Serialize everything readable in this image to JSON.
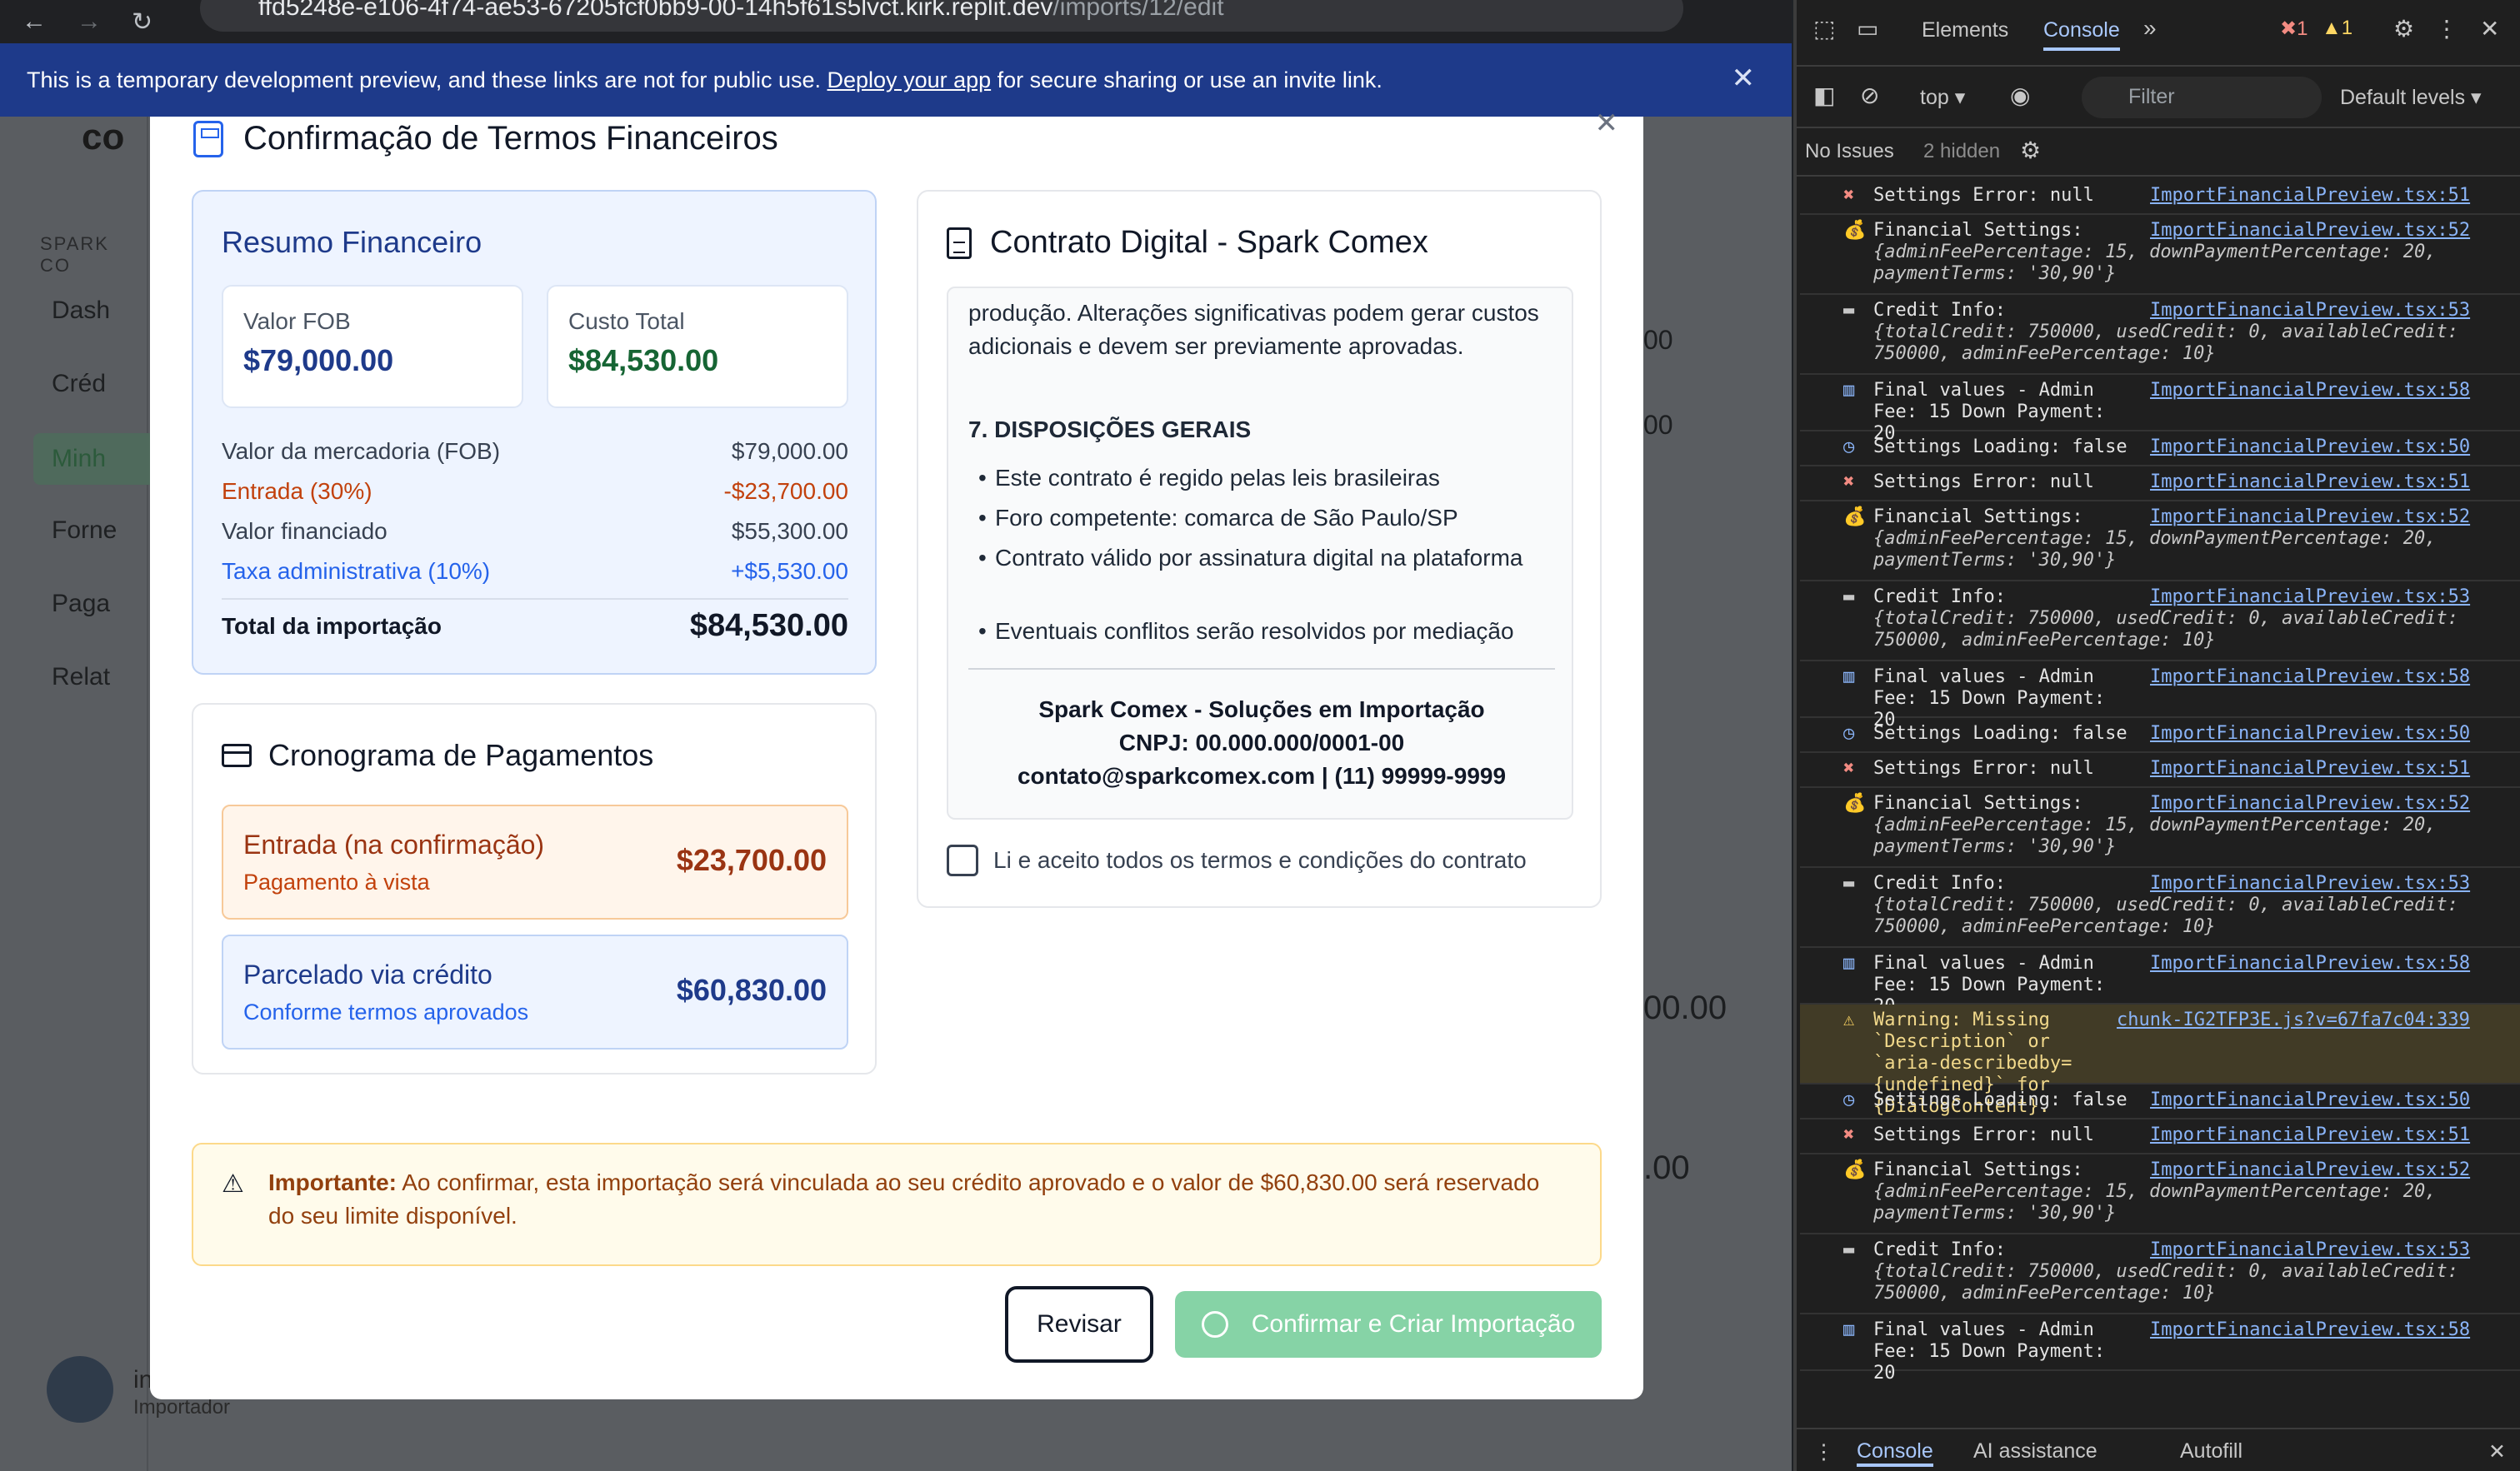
{
  "browser": {
    "url_main": "ffd5248e-e106-4f74-ae53-67205fcf0bb9-00-14h5f61s5lvct.kirk.replit.dev",
    "url_path": "/imports/12/edit"
  },
  "banner": {
    "text_before": "This is a temporary development preview, and these links are not for public use.",
    "link": "Deploy your app",
    "text_after": "for secure sharing or use an invite link."
  },
  "background": {
    "brand": "co",
    "section": "SPARK CO",
    "items": [
      "Dash",
      "Créd",
      "Minh",
      "Forne",
      "Paga",
      "Relat"
    ],
    "numbers": [
      "00",
      "00",
      "00.00",
      ".00"
    ],
    "user_name": "in",
    "user_role": "Importador"
  },
  "modal": {
    "title": "Confirmação de Termos Financeiros",
    "summary": {
      "title": "Resumo Financeiro",
      "fob_label": "Valor FOB",
      "fob_value": "$79,000.00",
      "total_label": "Custo Total",
      "total_value": "$84,530.00",
      "rows": [
        {
          "label": "Valor da mercadoria (FOB)",
          "value": "$79,000.00"
        },
        {
          "label": "Entrada (30%)",
          "value": "-$23,700.00"
        },
        {
          "label": "Valor financiado",
          "value": "$55,300.00"
        },
        {
          "label": "Taxa administrativa (10%)",
          "value": "+$5,530.00"
        }
      ],
      "grand_label": "Total da importação",
      "grand_value": "$84,530.00"
    },
    "schedule": {
      "title": "Cronograma de Pagamentos",
      "down_title": "Entrada (na confirmação)",
      "down_sub": "Pagamento à vista",
      "down_value": "$23,700.00",
      "credit_title": "Parcelado via crédito",
      "credit_sub": "Conforme termos aprovados",
      "credit_value": "$60,830.00"
    },
    "contract": {
      "title": "Contrato Digital - Spark Comex",
      "p1": "produção. Alterações significativas podem gerar custos adicionais e devem ser previamente aprovadas.",
      "section7": "7. DISPOSIÇÕES GERAIS",
      "items": [
        "Este contrato é regido pelas leis brasileiras",
        "Foro competente: comarca de São Paulo/SP",
        "Contrato válido por assinatura digital na plataforma",
        "Eventuais conflitos serão resolvidos por mediação"
      ],
      "company": "Spark Comex - Soluções em Importação",
      "cnpj": "CNPJ: 00.000.000/0001-00",
      "contact": "contato@sparkcomex.com | (11) 99999-9999",
      "accept": "Li e aceito todos os termos e condições do contrato"
    },
    "warning": {
      "bold": "Importante:",
      "text": "Ao confirmar, esta importação será vinculada ao seu crédito aprovado e o valor de $60,830.00 será reservado do seu limite disponível."
    },
    "review_button": "Revisar",
    "confirm_button": "Confirmar e Criar Importação"
  },
  "devtools": {
    "tabs": [
      "Elements",
      "Console"
    ],
    "error_count": "1",
    "warning_count": "1",
    "context": "top ▾",
    "filter": "Filter",
    "levels": "Default levels ▾",
    "no_issues": "No Issues",
    "hidden": "2 hidden",
    "logs": [
      {
        "type": "error",
        "msg": "Settings Error: null",
        "src": "ImportFinancialPreview.tsx:51"
      },
      {
        "type": "money",
        "msg": "Financial Settings:",
        "src": "ImportFinancialPreview.tsx:52",
        "obj": "{adminFeePercentage: 15, downPaymentPercentage: 20, paymentTerms: '30,90'}"
      },
      {
        "type": "card",
        "msg": "Credit Info:",
        "src": "ImportFinancialPreview.tsx:53",
        "obj": "{totalCredit: 750000, usedCredit: 0, availableCredit: 750000, adminFeePercentage: 10}"
      },
      {
        "type": "chart",
        "msg": "Final values - Admin Fee: 15 Down Payment: 20",
        "src": "ImportFinancialPreview.tsx:58"
      },
      {
        "type": "loading",
        "msg": "Settings Loading: false",
        "src": "ImportFinancialPreview.tsx:50"
      },
      {
        "type": "error",
        "msg": "Settings Error: null",
        "src": "ImportFinancialPreview.tsx:51"
      },
      {
        "type": "money",
        "msg": "Financial Settings:",
        "src": "ImportFinancialPreview.tsx:52",
        "obj": "{adminFeePercentage: 15, downPaymentPercentage: 20, paymentTerms: '30,90'}"
      },
      {
        "type": "card",
        "msg": "Credit Info:",
        "src": "ImportFinancialPreview.tsx:53",
        "obj": "{totalCredit: 750000, usedCredit: 0, availableCredit: 750000, adminFeePercentage: 10}"
      },
      {
        "type": "chart",
        "msg": "Final values - Admin Fee: 15 Down Payment: 20",
        "src": "ImportFinancialPreview.tsx:58"
      },
      {
        "type": "loading",
        "msg": "Settings Loading: false",
        "src": "ImportFinancialPreview.tsx:50"
      },
      {
        "type": "error",
        "msg": "Settings Error: null",
        "src": "ImportFinancialPreview.tsx:51"
      },
      {
        "type": "money",
        "msg": "Financial Settings:",
        "src": "ImportFinancialPreview.tsx:52",
        "obj": "{adminFeePercentage: 15, downPaymentPercentage: 20, paymentTerms: '30,90'}"
      },
      {
        "type": "card",
        "msg": "Credit Info:",
        "src": "ImportFinancialPreview.tsx:53",
        "obj": "{totalCredit: 750000, usedCredit: 0, availableCredit: 750000, adminFeePercentage: 10}"
      },
      {
        "type": "chart",
        "msg": "Final values - Admin Fee: 15 Down Payment: 20",
        "src": "ImportFinancialPreview.tsx:58"
      },
      {
        "type": "warning",
        "msg": "Warning: Missing `Description` or `aria-describedby={undefined}` for {DialogContent}.",
        "src": "chunk-IG2TFP3E.js?v=67fa7c04:339"
      },
      {
        "type": "loading",
        "msg": "Settings Loading: false",
        "src": "ImportFinancialPreview.tsx:50"
      },
      {
        "type": "error",
        "msg": "Settings Error: null",
        "src": "ImportFinancialPreview.tsx:51"
      },
      {
        "type": "money",
        "msg": "Financial Settings:",
        "src": "ImportFinancialPreview.tsx:52",
        "obj": "{adminFeePercentage: 15, downPaymentPercentage: 20, paymentTerms: '30,90'}"
      },
      {
        "type": "card",
        "msg": "Credit Info:",
        "src": "ImportFinancialPreview.tsx:53",
        "obj": "{totalCredit: 750000, usedCredit: 0, availableCredit: 750000, adminFeePercentage: 10}"
      },
      {
        "type": "chart",
        "msg": "Final values - Admin Fee: 15 Down Payment: 20",
        "src": "ImportFinancialPreview.tsx:58"
      }
    ],
    "bottom_tabs": [
      "Console",
      "AI assistance",
      "Autofill"
    ]
  }
}
